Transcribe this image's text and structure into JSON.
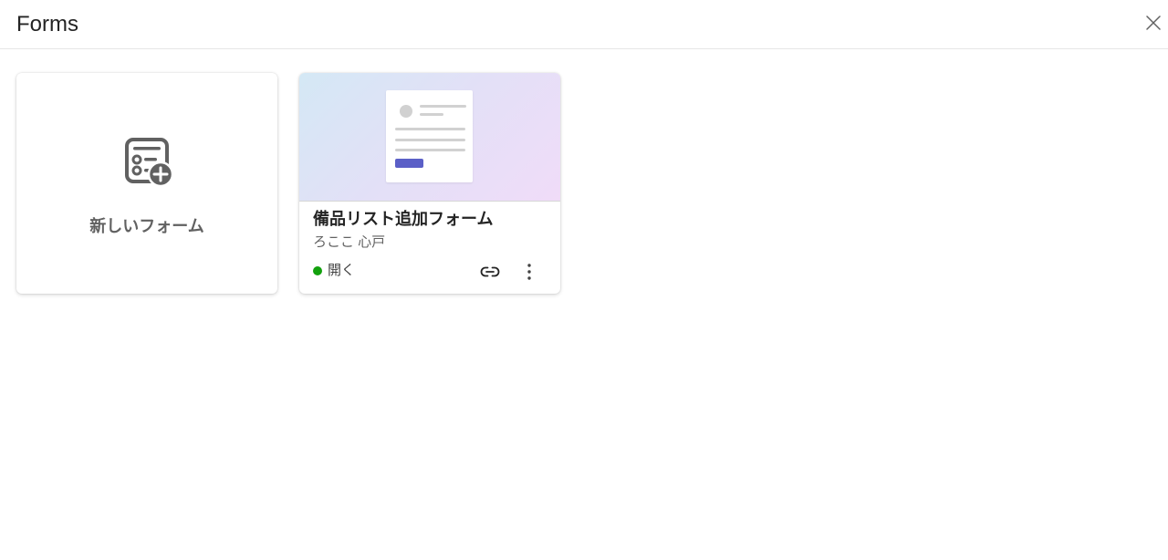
{
  "header": {
    "title": "Forms",
    "close_icon": "close-icon"
  },
  "new_form": {
    "label": "新しいフォーム",
    "icon": "form-add-icon"
  },
  "forms": [
    {
      "title": "備品リスト追加フォーム",
      "owner": "ろここ 心戸",
      "status": "開く",
      "status_color": "#13a10e",
      "actions": [
        "link-icon",
        "more-vertical-icon"
      ]
    }
  ],
  "colors": {
    "accent": "#5b5fc7",
    "status_open": "#13a10e"
  }
}
